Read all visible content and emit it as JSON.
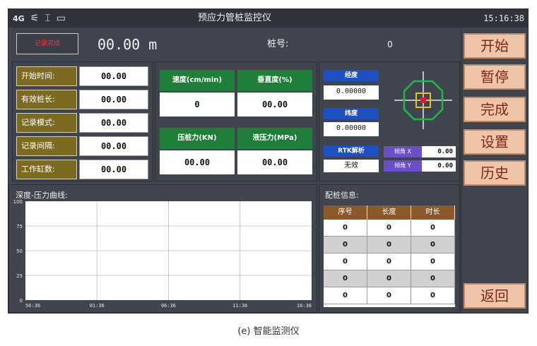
{
  "header": {
    "status_icons": [
      "4G",
      "⚟",
      "⌶",
      "▭"
    ],
    "title": "预应力管桩监控仪",
    "time": "15:16:38"
  },
  "top_row": {
    "record_button": "记录完成",
    "depth": "00.00 m",
    "pile_no_label": "桩号:",
    "pile_no_value": "0"
  },
  "params": [
    {
      "label": "开始时间:",
      "value": "00.00"
    },
    {
      "label": "有效桩长:",
      "value": "00.00"
    },
    {
      "label": "记录模式:",
      "value": "00.00"
    },
    {
      "label": "记录间隔:",
      "value": "00.00"
    },
    {
      "label": "工作缸数:",
      "value": "00.00"
    }
  ],
  "metrics": [
    {
      "label": "速度(cm/min)",
      "value": "0"
    },
    {
      "label": "垂直度(%)",
      "value": "00.00"
    },
    {
      "label": "压桩力(KN)",
      "value": "00.00"
    },
    {
      "label": "液压力(MPa)",
      "value": "00.00"
    }
  ],
  "gps": {
    "longitude_label": "经度",
    "longitude_value": "0.00000",
    "latitude_label": "纬度",
    "latitude_value": "0.00000",
    "rtk_label": "RTK解析",
    "rtk_value": "无效",
    "tilt_x_label": "倾角 X",
    "tilt_x_value": "0.00",
    "tilt_y_label": "倾角 Y",
    "tilt_y_value": "0.00",
    "colors": {
      "octagon": "#1fb84a",
      "square": "#e6c21a",
      "center": "#e02020"
    }
  },
  "side_buttons": {
    "start": "开始",
    "pause": "暂停",
    "finish": "完成",
    "settings": "设置",
    "history": "历史",
    "back": "返回"
  },
  "chart_section_title": "深度-压力曲线:",
  "chart_data": {
    "type": "line",
    "title": "深度-压力曲线:",
    "categories": [
      "56:36",
      "01:36",
      "06:36",
      "11:36",
      "16:36"
    ],
    "yticks": [
      0,
      25,
      50,
      75,
      100
    ],
    "ylim": [
      0,
      100
    ],
    "series": [],
    "grid": true
  },
  "pile_info": {
    "title": "配桩信息:",
    "headers": [
      "序号",
      "长度",
      "时长"
    ],
    "rows": [
      [
        "0",
        "0",
        "0"
      ],
      [
        "0",
        "0",
        "0"
      ],
      [
        "0",
        "0",
        "0"
      ],
      [
        "0",
        "0",
        "0"
      ],
      [
        "0",
        "0",
        "0"
      ]
    ]
  },
  "caption": "(e) 智能监测仪"
}
